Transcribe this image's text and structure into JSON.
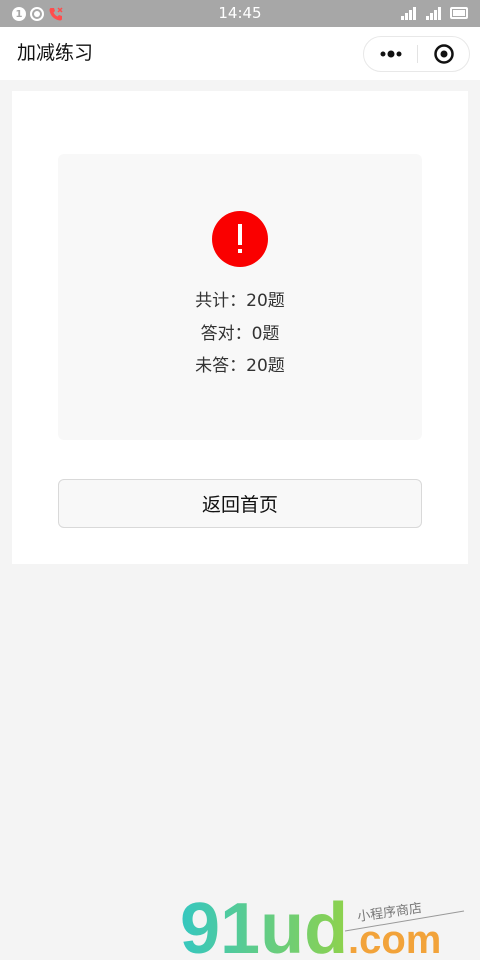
{
  "status_bar": {
    "time": "14:45",
    "notification_count": "1",
    "icons": [
      "notification-count-icon",
      "record-icon",
      "missed-call-icon",
      "signal-icon",
      "signal-icon",
      "battery-icon"
    ]
  },
  "nav": {
    "title": "加减练习",
    "more_icon": "more-dots-icon",
    "close_icon": "target-close-icon"
  },
  "result": {
    "status_icon": "exclamation-icon",
    "status_color": "#fa0000",
    "total_text": "共计：20题",
    "correct_text": "答对：0题",
    "unanswered_text": "未答：20题"
  },
  "actions": {
    "return_home_label": "返回首页"
  },
  "watermark": {
    "logo_text": "91ud",
    "suffix": ".com",
    "tagline": "小程序商店"
  },
  "colors": {
    "page_background": "#f4f4f4",
    "status_bar": "#a7a7a7",
    "alert_red": "#fa0000"
  }
}
